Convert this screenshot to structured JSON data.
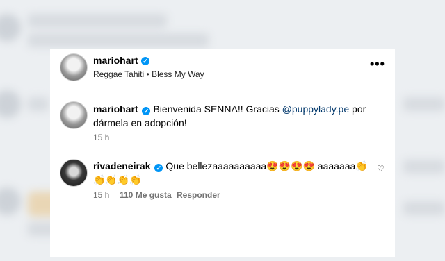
{
  "post": {
    "username": "mariohart",
    "audio": "Reggae Tahiti",
    "separator": "•",
    "song": "Bless My Way",
    "more_icon": "more-dots-icon"
  },
  "caption": {
    "username": "mariohart",
    "text_before": "Bienvenida SENNA!! Gracias ",
    "mention": "@puppylady.pe",
    "text_after_line1": " por",
    "text_line2": "dármela en adopción!",
    "time": "15 h"
  },
  "comment": {
    "username": "rivadeneirak",
    "text_line1": "Que bellezaaaaaaaaaa😍😍😍😍 aaaaaaa👏",
    "text_line2": "👏👏👏👏",
    "time": "15 h",
    "likes": "110 Me gusta",
    "reply": "Responder",
    "like_icon": "heart-icon"
  },
  "colors": {
    "verified": "#0095f6",
    "mention": "#00376b",
    "secondary_text": "#737373"
  }
}
